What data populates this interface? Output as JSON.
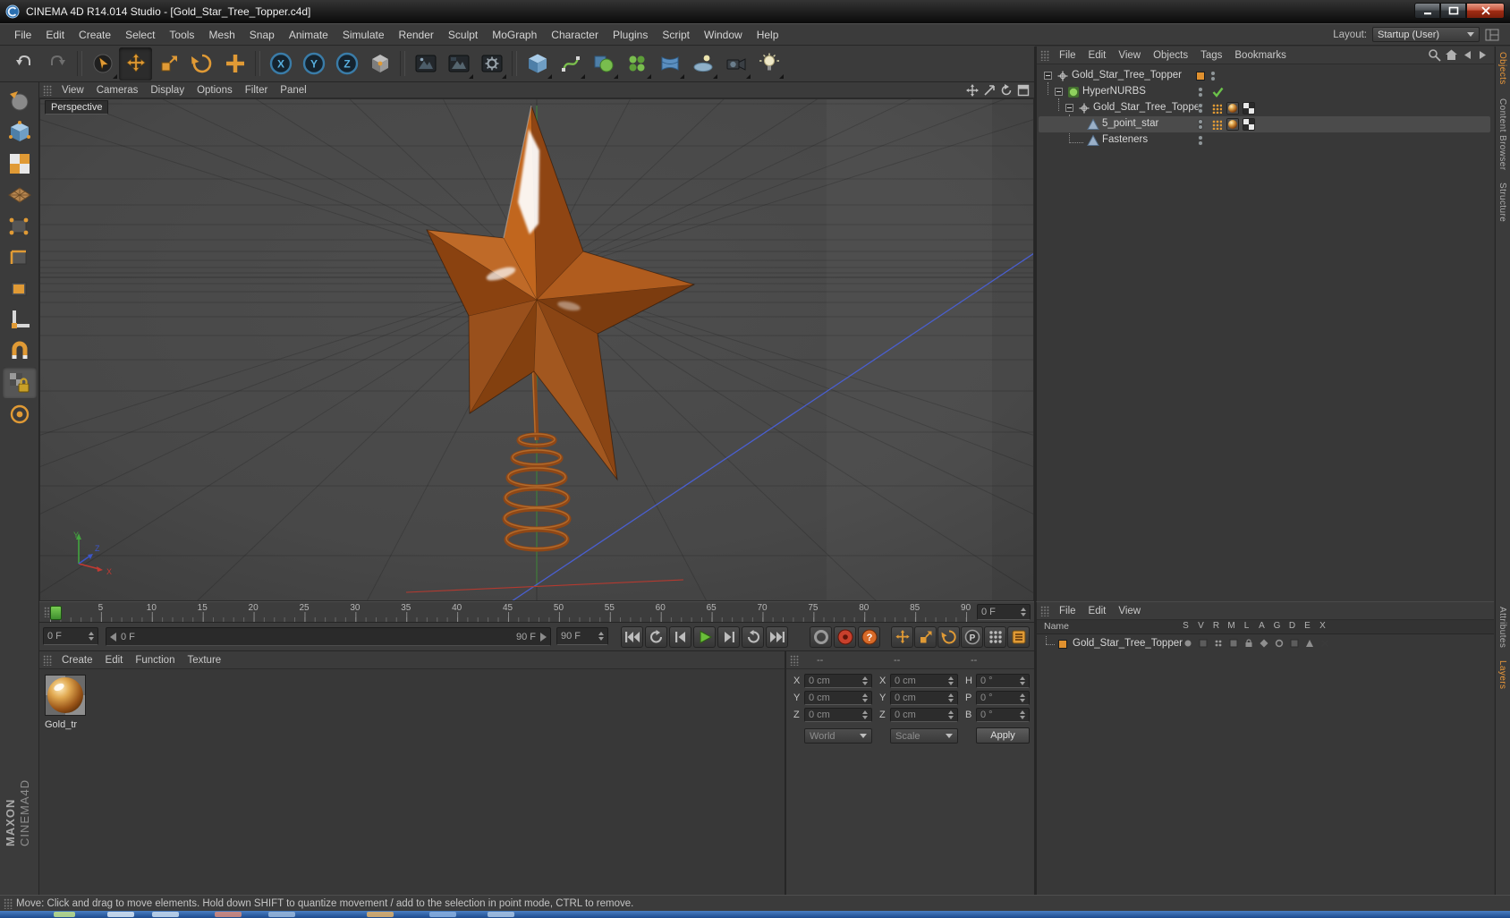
{
  "window": {
    "title": "CINEMA 4D R14.014 Studio - [Gold_Star_Tree_Topper.c4d]"
  },
  "branding": {
    "maxon": "MAXON",
    "cinema": "CINEMA4D"
  },
  "menu_bar": {
    "items": [
      "File",
      "Edit",
      "Create",
      "Select",
      "Tools",
      "Mesh",
      "Snap",
      "Animate",
      "Simulate",
      "Render",
      "Sculpt",
      "MoGraph",
      "Character",
      "Plugins",
      "Script",
      "Window",
      "Help"
    ],
    "layout_label": "Layout:",
    "layout_value": "Startup (User)"
  },
  "toolbar": {
    "axis_x": "X",
    "axis_y": "Y",
    "axis_z": "Z"
  },
  "glyphs": {
    "question": "?",
    "parameter": "P"
  },
  "viewport": {
    "menu": [
      "View",
      "Cameras",
      "Display",
      "Options",
      "Filter",
      "Panel"
    ],
    "camera_label": "Perspective",
    "axis_x": "X",
    "axis_y": "Y",
    "axis_z": "Z"
  },
  "timeline": {
    "tick_labels": [
      "5",
      "10",
      "15",
      "20",
      "25",
      "30",
      "35",
      "40",
      "45",
      "50",
      "55",
      "60",
      "65",
      "70",
      "75",
      "80",
      "85",
      "90"
    ],
    "frame_spin": "0 F",
    "range_start_combo": "0 F",
    "range_start": "0 F",
    "range_end": "90 F",
    "range_end_spin": "90 F"
  },
  "material_manager": {
    "menu": [
      "Create",
      "Edit",
      "Function",
      "Texture"
    ],
    "material_label": "Gold_tr"
  },
  "coordinates": {
    "headers": [
      "--",
      "--",
      "--"
    ],
    "labels": {
      "px": "X",
      "py": "Y",
      "pz": "Z",
      "sx": "X",
      "sy": "Y",
      "sz": "Z",
      "rh": "H",
      "rp": "P",
      "rb": "B"
    },
    "values": {
      "px": "0 cm",
      "py": "0 cm",
      "pz": "0 cm",
      "sx": "0 cm",
      "sy": "0 cm",
      "sz": "0 cm",
      "rh": "0 °",
      "rp": "0 °",
      "rb": "0 °"
    },
    "combo_world": "World",
    "combo_scale": "Scale",
    "apply": "Apply"
  },
  "object_manager": {
    "menu": [
      "File",
      "Edit",
      "View",
      "Objects",
      "Tags",
      "Bookmarks"
    ],
    "objects": [
      "Gold_Star_Tree_Topper",
      "HyperNURBS",
      "Gold_Star_Tree_Topper",
      "5_point_star",
      "Fasteners"
    ]
  },
  "layers": {
    "menu": [
      "File",
      "Edit",
      "View"
    ],
    "name_header": "Name",
    "columns": [
      "S",
      "V",
      "R",
      "M",
      "L",
      "A",
      "G",
      "D",
      "E",
      "X"
    ],
    "row_name": "Gold_Star_Tree_Topper"
  },
  "side_tabs": {
    "objects": "Objects",
    "content_browser": "Content Browser",
    "structure": "Structure",
    "attributes": "Attributes",
    "layers": "Layers"
  },
  "status_bar": {
    "text": "Move: Click and drag to move elements. Hold down SHIFT to quantize movement / add to the selection in point mode, CTRL to remove."
  },
  "colors": {
    "accent_orange": "#e0912f",
    "star_brown": "#a8551b",
    "play_green": "#63c03c",
    "record_red": "#cc3b28",
    "axis_x_red": "#c23a32",
    "axis_y_green": "#43a33f",
    "axis_z_blue": "#3c55c8"
  }
}
